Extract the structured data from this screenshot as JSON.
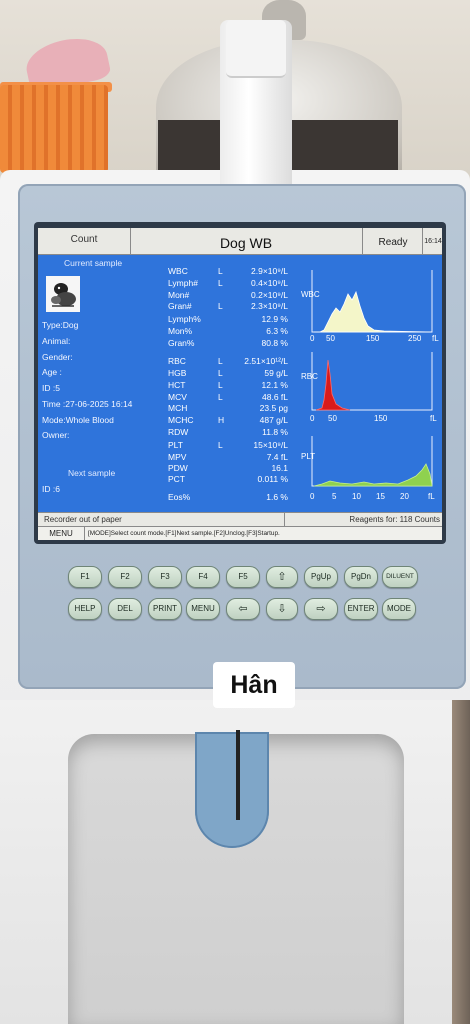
{
  "header": {
    "mode_tab": "Count",
    "title": "Dog  WB",
    "status": "Ready",
    "clock": "16:14"
  },
  "sample": {
    "current_label": "Current sample",
    "type": "Type:Dog",
    "animal": "Animal:",
    "gender": "Gender:",
    "age": "Age  :",
    "id": "ID    :5",
    "time": "Time :27-06-2025 16:14",
    "mode": "Mode:Whole Blood",
    "owner": "Owner:",
    "next_label": "Next sample",
    "next_id": "ID    :6"
  },
  "results": [
    {
      "name": "WBC",
      "flag": "L",
      "value": "2.9×10⁹/L"
    },
    {
      "name": "Lymph#",
      "flag": "L",
      "value": "0.4×10⁹/L"
    },
    {
      "name": "Mon#",
      "flag": "",
      "value": "0.2×10⁹/L"
    },
    {
      "name": "Gran#",
      "flag": "L",
      "value": "2.3×10⁹/L"
    },
    {
      "name": "Lymph%",
      "flag": "",
      "value": "12.9 %"
    },
    {
      "name": "Mon%",
      "flag": "",
      "value": "6.3 %"
    },
    {
      "name": "Gran%",
      "flag": "",
      "value": "80.8 %"
    },
    {
      "name": "RBC",
      "flag": "L",
      "value": "2.51×10¹²/L"
    },
    {
      "name": "HGB",
      "flag": "L",
      "value": "59 g/L"
    },
    {
      "name": "HCT",
      "flag": "L",
      "value": "12.1 %"
    },
    {
      "name": "MCV",
      "flag": "L",
      "value": "48.6 fL"
    },
    {
      "name": "MCH",
      "flag": "",
      "value": "23.5 pg"
    },
    {
      "name": "MCHC",
      "flag": "H",
      "value": "487 g/L"
    },
    {
      "name": "RDW",
      "flag": "",
      "value": "11.8 %"
    },
    {
      "name": "PLT",
      "flag": "L",
      "value": "15×10⁹/L"
    },
    {
      "name": "MPV",
      "flag": "",
      "value": "7.4 fL"
    },
    {
      "name": "PDW",
      "flag": "",
      "value": "16.1"
    },
    {
      "name": "PCT",
      "flag": "",
      "value": "0.011 %"
    },
    {
      "name": "Eos%",
      "flag": "",
      "value": "1.6 %"
    }
  ],
  "histograms": {
    "wbc": {
      "label": "WBC",
      "ticks": [
        "0",
        "50",
        "150",
        "250"
      ],
      "unit": "fL",
      "color": "#f4f6c9"
    },
    "rbc": {
      "label": "RBC",
      "ticks": [
        "0",
        "50",
        "150"
      ],
      "unit": "fL",
      "color": "#d81b1b"
    },
    "plt": {
      "label": "PLT",
      "ticks": [
        "0",
        "5",
        "10",
        "15",
        "20"
      ],
      "unit": "fL",
      "color": "#8fd14f"
    }
  },
  "status_bar": {
    "left": "Recorder out of paper",
    "right": "Reagents for:  118 Counts"
  },
  "help_bar": {
    "menu": "MENU",
    "text": "[MODE]Select count mode.[F1]Next sample.[F2]Unclog.[F3]Startup."
  },
  "keys": {
    "f1": "F1",
    "f2": "F2",
    "f3": "F3",
    "f4": "F4",
    "f5": "F5",
    "up": "⇧",
    "pgup": "PgUp",
    "pgdn": "PgDn",
    "diluent": "DILUENT",
    "help": "HELP",
    "del": "DEL",
    "print": "PRINT",
    "menu": "MENU",
    "left": "⇦",
    "down": "⇩",
    "right": "⇨",
    "enter": "ENTER",
    "mode": "MODE"
  },
  "overlay_name": "Hân",
  "colors": {
    "screen_bg": "#2f74db",
    "panel": "#b8c7d6",
    "key_face": "#cfe0d1"
  }
}
